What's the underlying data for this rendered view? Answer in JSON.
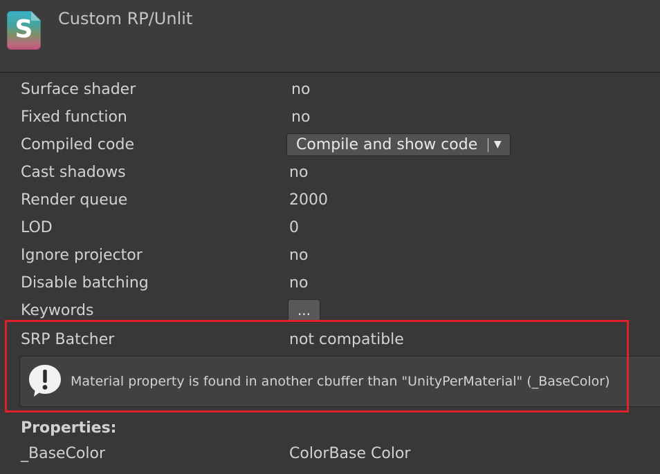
{
  "header": {
    "icon_letter": "S",
    "title": "Custom RP/Unlit"
  },
  "properties_table": [
    {
      "label": "Surface shader",
      "value": "no"
    },
    {
      "label": "Fixed function",
      "value": "no"
    },
    {
      "label": "Compiled code",
      "dropdown": "Compile and show code"
    },
    {
      "label": "Cast shadows",
      "value": "no"
    },
    {
      "label": "Render queue",
      "value": "2000"
    },
    {
      "label": "LOD",
      "value": "0"
    },
    {
      "label": "Ignore projector",
      "value": "no"
    },
    {
      "label": "Disable batching",
      "value": "no"
    },
    {
      "label": "Keywords",
      "button": "..."
    },
    {
      "label": "SRP Batcher",
      "value": "not compatible"
    }
  ],
  "dropdown_arrow": "▼",
  "warning": {
    "icon": "warning-speech-icon",
    "message": "Material property is found in another cbuffer than \"UnityPerMaterial\" (_BaseColor)"
  },
  "properties_section": {
    "title": "Properties:",
    "items": [
      {
        "name": "_BaseColor",
        "value": "ColorBase Color"
      }
    ]
  },
  "colors": {
    "background": "#383838",
    "highlight": "#e0202a"
  }
}
